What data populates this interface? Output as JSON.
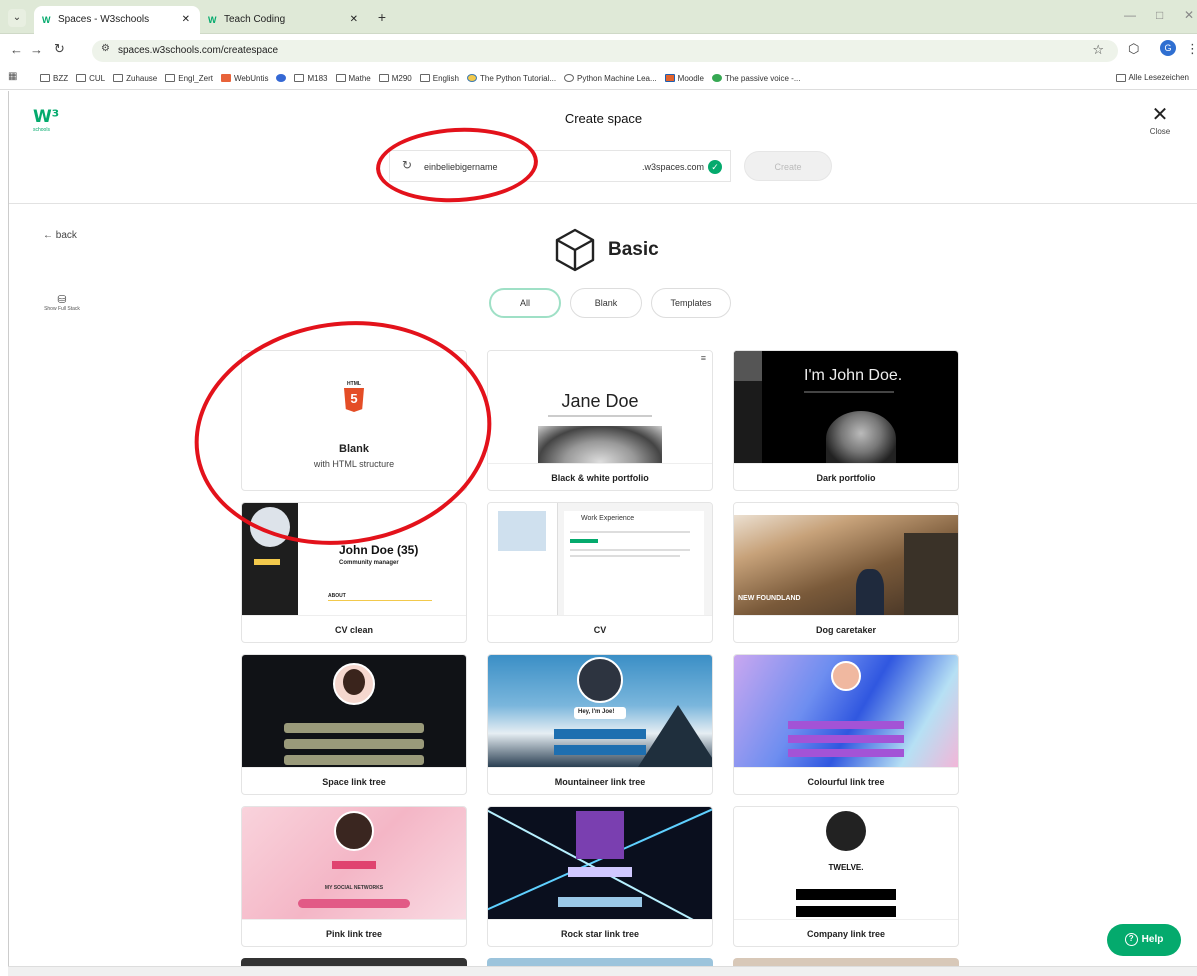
{
  "browser": {
    "tabs": [
      {
        "title": "Spaces - W3schools",
        "active": true
      },
      {
        "title": "Teach Coding",
        "active": false
      }
    ],
    "url": "spaces.w3schools.com/createspace",
    "bookmarks": [
      "BZZ",
      "CUL",
      "Zuhause",
      "Engl_Zert",
      "WebUntis",
      "",
      "M183",
      "Mathe",
      "M290",
      "English",
      "The Python Tutorial...",
      "Python Machine Lea...",
      "Moodle",
      "The passive voice -..."
    ],
    "other_bookmarks": "Alle Lesezeichen",
    "profile_initial": "G"
  },
  "header": {
    "title": "Create space",
    "close_label": "Close",
    "name_value": "einbeliebigername",
    "domain_suffix": ".w3spaces.com",
    "create_button": "Create"
  },
  "nav": {
    "back_label": "← back",
    "full_stack_label": "Show Full Stack"
  },
  "section": {
    "title": "Basic",
    "filters": [
      "All",
      "Blank",
      "Templates"
    ],
    "active_filter": "All"
  },
  "templates": [
    {
      "label": "Blank",
      "subtitle": "with HTML structure",
      "badge": "HTML",
      "badge_glyph": "5"
    },
    {
      "label": "Black & white portfolio",
      "heading": "Jane Doe"
    },
    {
      "label": "Dark portfolio",
      "heading": "I'm John Doe."
    },
    {
      "label": "CV clean",
      "heading": "John Doe (35)",
      "subheading": "Community manager",
      "section": "ABOUT"
    },
    {
      "label": "CV",
      "heading": "Work Experience"
    },
    {
      "label": "Dog caretaker",
      "overlay": "NEW FOUNDLAND"
    },
    {
      "label": "Space link tree"
    },
    {
      "label": "Mountaineer link tree",
      "overlay": "Hey, I'm Joe!"
    },
    {
      "label": "Colourful link tree"
    },
    {
      "label": "Pink link tree",
      "overlay": "MY SOCIAL NETWORKS"
    },
    {
      "label": "Rock star link tree"
    },
    {
      "label": "Company link tree",
      "overlay": "TWELVE."
    }
  ],
  "help_label": "Help",
  "colors": {
    "brand": "#04aa6d",
    "annotation": "#e3121b"
  }
}
